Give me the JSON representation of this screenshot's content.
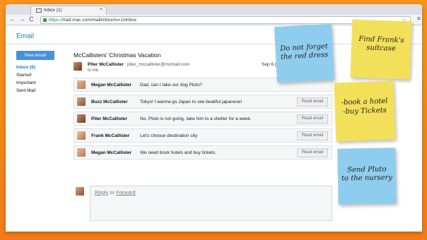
{
  "browser": {
    "tab_title": "Inbox (1)",
    "tab_close": "×",
    "url_scheme": "https://",
    "url_rest": "mail.mac.com/mail/inbox#v=1#inbox",
    "nav_back": "←",
    "nav_forward": "→",
    "nav_reload": "C",
    "star": "☆",
    "menu": "≡"
  },
  "app": {
    "title": "Email",
    "compose_label": "New email",
    "folders": [
      "Inbox (6)",
      "Starred",
      "Important",
      "Sent Mail"
    ]
  },
  "thread": {
    "subject": "McCallisters' Christmas Vacation",
    "header": {
      "sender": "Piter McCallister",
      "email": "piter_mccallister@mcmail.com",
      "to": "to me",
      "date": "Sep 6 ("
    },
    "messages": [
      {
        "sender": "Megan McCallister",
        "text": "Dad, can I take our dog Pluto?",
        "button": ""
      },
      {
        "sender": "Buzz McCallister",
        "text": "Tokyo! I wanna go Japan to see beatiful japanese!",
        "button": "Read email"
      },
      {
        "sender": "Piter McCallister",
        "text": "No, Pluto is not going, take him to a shelter for a week.",
        "button": "Read email"
      },
      {
        "sender": "Frank McCallister",
        "text": "Let's choose destination city",
        "button": "Read email"
      },
      {
        "sender": "Megan McCallister",
        "text": "We need book hotels and buy tickets.",
        "button": "Read email"
      }
    ],
    "reply": {
      "reply_label": "Reply",
      "or_label": "or",
      "forward_label": "Forward"
    }
  },
  "notes": [
    {
      "text_1": "Do not forget",
      "text_2": "the red dress",
      "color": "#8fcdee"
    },
    {
      "text_1": "Find Frank's",
      "text_2": "suitcase",
      "color": "#f3e05a"
    },
    {
      "text_1": "-book a hotel",
      "text_2": "-buy Tickets",
      "color": "#f3e05a"
    },
    {
      "text_1": "Send Pluto",
      "text_2": "to the nursery",
      "color": "#8fcdee"
    }
  ]
}
